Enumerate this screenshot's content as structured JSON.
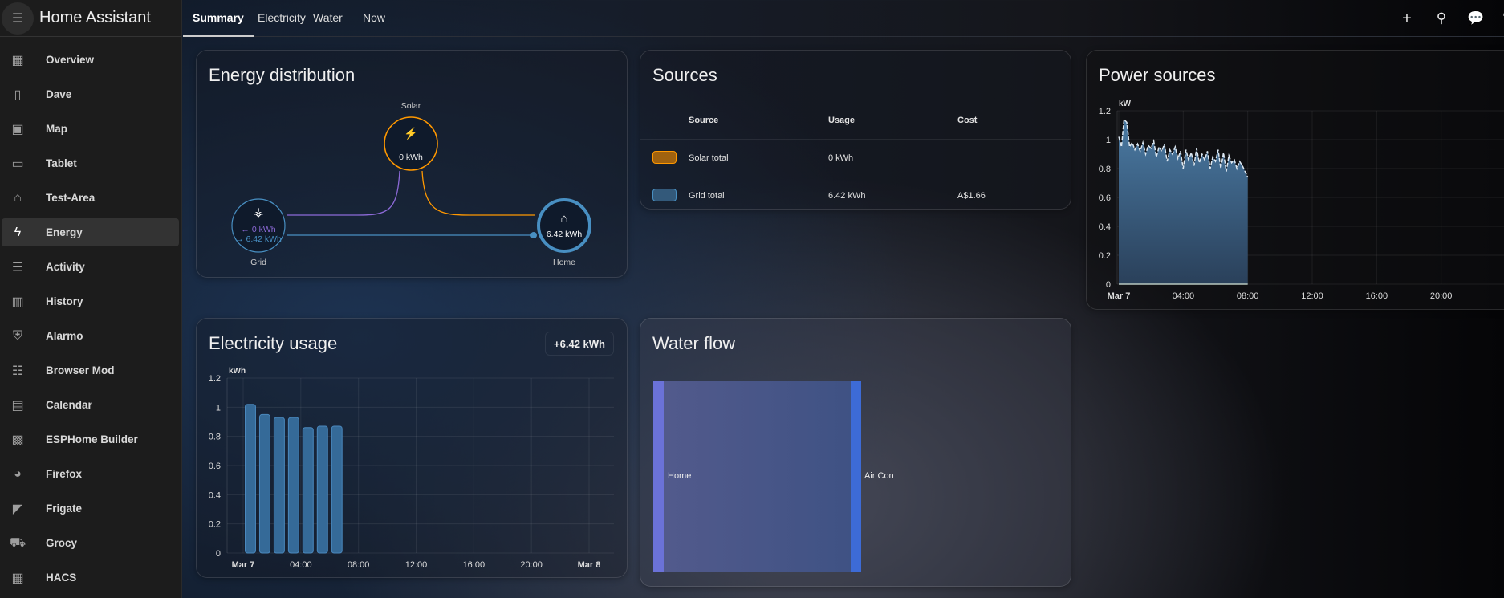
{
  "app": {
    "title": "Home Assistant"
  },
  "sidebar": {
    "items": [
      {
        "label": "Overview",
        "icon": "dashboard-icon",
        "glyph": "▦"
      },
      {
        "label": "Dave",
        "icon": "tablet-check-icon",
        "glyph": "▯"
      },
      {
        "label": "Map",
        "icon": "map-account-icon",
        "glyph": "▣"
      },
      {
        "label": "Tablet",
        "icon": "tablet-icon",
        "glyph": "▭"
      },
      {
        "label": "Test-Area",
        "icon": "home-circle-icon",
        "glyph": "⌂"
      },
      {
        "label": "Energy",
        "icon": "lightning-icon",
        "glyph": "ϟ",
        "active": true
      },
      {
        "label": "Activity",
        "icon": "list-icon",
        "glyph": "☰"
      },
      {
        "label": "History",
        "icon": "chart-box-icon",
        "glyph": "▥"
      },
      {
        "label": "Alarmo",
        "icon": "shield-home-icon",
        "glyph": "⛨"
      },
      {
        "label": "Browser Mod",
        "icon": "server-icon",
        "glyph": "☷"
      },
      {
        "label": "Calendar",
        "icon": "calendar-icon",
        "glyph": "▤"
      },
      {
        "label": "ESPHome Builder",
        "icon": "chip-icon",
        "glyph": "▩"
      },
      {
        "label": "Firefox",
        "icon": "firefox-icon",
        "glyph": "◕"
      },
      {
        "label": "Frigate",
        "icon": "cctv-icon",
        "glyph": "◤"
      },
      {
        "label": "Grocy",
        "icon": "cart-icon",
        "glyph": "⛟"
      },
      {
        "label": "HACS",
        "icon": "hacs-store-icon",
        "glyph": "▦"
      }
    ]
  },
  "tabs": [
    {
      "label": "Summary",
      "active": true
    },
    {
      "label": "Electricity"
    },
    {
      "label": "Water"
    },
    {
      "label": "Now"
    }
  ],
  "toolbar": {
    "icons": [
      "plus-icon",
      "search-icon",
      "assist-chat-icon",
      "edit-pencil-icon"
    ]
  },
  "energy_distribution": {
    "title": "Energy distribution",
    "solar": {
      "label": "Solar",
      "value": "0 kWh",
      "color": "#ff9800"
    },
    "grid": {
      "label": "Grid",
      "from_grid": "← 0 kWh",
      "to_grid": "→ 6.42 kWh",
      "color": "#488fc2",
      "return_color": "#8353d1"
    },
    "home": {
      "label": "Home",
      "value": "6.42 kWh",
      "color": "#488fc2"
    }
  },
  "sources": {
    "title": "Sources",
    "columns": [
      "Source",
      "Usage",
      "Cost"
    ],
    "rows": [
      {
        "name": "Solar total",
        "usage": "0 kWh",
        "cost": "",
        "color": "#ff9800"
      },
      {
        "name": "Grid total",
        "usage": "6.42 kWh",
        "cost": "A$1.66",
        "color": "#488fc2"
      }
    ]
  },
  "power_sources": {
    "title": "Power sources"
  },
  "electricity_usage": {
    "title": "Electricity usage",
    "total": "+6.42 kWh"
  },
  "water_flow": {
    "title": "Water flow",
    "source": "Home",
    "target": "Air Con",
    "source_color": "#6b72d8",
    "target_color": "#3d6bd6"
  },
  "chart_data": [
    {
      "type": "area",
      "title": "Power sources",
      "ylabel": "kW",
      "ylim": [
        0,
        1.2
      ],
      "yticks": [
        "0",
        "0.2",
        "0.4",
        "0.6",
        "0.8",
        "1",
        "1.2"
      ],
      "xticks": [
        "Mar 7",
        "04:00",
        "08:00",
        "12:00",
        "16:00",
        "20:00"
      ],
      "xlim_hours": [
        0,
        24
      ],
      "grid": true,
      "color": "#488fc2",
      "x_hours": [
        0,
        0.17,
        0.33,
        0.5,
        0.67,
        0.83,
        1,
        1.17,
        1.33,
        1.5,
        1.67,
        1.83,
        2,
        2.17,
        2.33,
        2.5,
        2.67,
        2.83,
        3,
        3.17,
        3.33,
        3.5,
        3.67,
        3.83,
        4,
        4.17,
        4.33,
        4.5,
        4.67,
        4.83,
        5,
        5.17,
        5.33,
        5.5,
        5.67,
        5.83,
        6,
        6.17,
        6.33,
        6.5,
        6.67,
        6.83,
        7,
        7.17,
        7.33,
        7.5,
        7.67,
        8
      ],
      "values": [
        1.02,
        0.95,
        1.14,
        1.12,
        0.95,
        0.98,
        0.93,
        0.97,
        0.92,
        0.98,
        0.9,
        0.96,
        0.94,
        0.99,
        0.88,
        0.95,
        0.92,
        0.97,
        0.85,
        0.93,
        0.9,
        0.95,
        0.87,
        0.92,
        0.8,
        0.93,
        0.86,
        0.91,
        0.82,
        0.94,
        0.84,
        0.9,
        0.86,
        0.92,
        0.8,
        0.88,
        0.85,
        0.93,
        0.8,
        0.91,
        0.78,
        0.89,
        0.84,
        0.86,
        0.8,
        0.85,
        0.82,
        0.74
      ]
    },
    {
      "type": "bar",
      "title": "Electricity usage",
      "ylabel": "kWh",
      "ylim": [
        0,
        1.2
      ],
      "yticks": [
        "0",
        "0.2",
        "0.4",
        "0.6",
        "0.8",
        "1",
        "1.2"
      ],
      "xticks": [
        "Mar 7",
        "04:00",
        "08:00",
        "12:00",
        "16:00",
        "20:00",
        "Mar 8"
      ],
      "xlim_hours": [
        0,
        24
      ],
      "grid": true,
      "color": "#488fc2",
      "categories": [
        "00:00",
        "01:00",
        "02:00",
        "03:00",
        "04:00",
        "05:00",
        "06:00"
      ],
      "values": [
        1.02,
        0.95,
        0.93,
        0.93,
        0.86,
        0.87,
        0.87
      ]
    }
  ]
}
